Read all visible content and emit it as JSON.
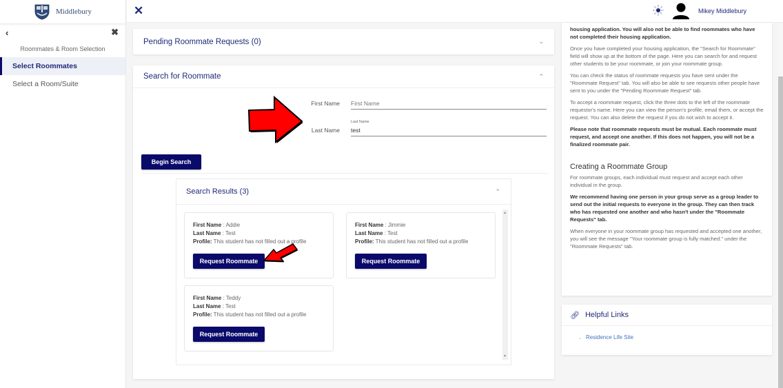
{
  "brand": {
    "name": "Middlebury"
  },
  "sidebar": {
    "section_title": "Roommates & Room Selection",
    "items": [
      {
        "label": "Select Roommates",
        "active": true
      },
      {
        "label": "Select a Room/Suite",
        "active": false
      }
    ]
  },
  "topbar": {
    "user_name": "Mikey Middlebury"
  },
  "pending_panel": {
    "title": "Pending Roommate Requests (0)"
  },
  "search_panel": {
    "title": "Search for Roommate",
    "first_name": {
      "label": "First Name",
      "placeholder": "First Name",
      "value": ""
    },
    "last_name": {
      "label": "Last Name",
      "float_label": "Last Name",
      "value": "test"
    },
    "begin_button": "Begin Search"
  },
  "results_panel": {
    "title": "Search Results",
    "count": "(3)",
    "labels": {
      "first": "First Name",
      "last": "Last Name",
      "profile": "Profile:"
    },
    "request_button": "Request Roommate",
    "results": [
      {
        "first": "Addie",
        "last": "Test",
        "profile": "This student has not filled out a profile"
      },
      {
        "first": "Jimmie",
        "last": "Test",
        "profile": "This student has not filled out a profile"
      },
      {
        "first": "Teddy",
        "last": "Test",
        "profile": "This student has not filled out a profile"
      }
    ]
  },
  "info_panel": {
    "p1": "housing application. You will also not be able to find roommates who have not completed their housing application.",
    "p2": "Once you have completed your housing application, the \"Search for Roommate\" field will show up at the bottom of the page. Here you can search for and request other students to be your roommate, or join your roommate group.",
    "p3": "You can check the status of roommate requests you have sent under the \"Roommate Request\" tab. You will also be able to see requests other people have sent to you under the \"Pending Roommate Request\" tab.",
    "p4": "To accept a roommate request, click the three dots to the left of the roommate requestor's name. Here you can view the person's profile, email them, or accept the request. You can also delete the request if you do not wish to accept it.",
    "p5": "Please note that roommate requests must be mutual. Each roommate must request, and accept one another. If this does not happen, you will not be a finalized roommate pair.",
    "group_heading": "Creating a Roommate Group",
    "g1": "For roommate groups, each individual must request and accept each other individual in the group.",
    "g2": "We recommend having one person in your group serve as a group leader to send out the initial requests to everyone in the group. They can then track who has requested one another and who hasn't under the \"Roommate Requests\" tab.",
    "g3": "When everyone in your roommate group has requested and accepted one another, you will see the message \"Your roommate group is fully matched.\" under the \"Roommate Requests\" tab."
  },
  "links_panel": {
    "title": "Helpful Links",
    "links": [
      {
        "label": "Residence Life Site"
      }
    ]
  },
  "annotations": {
    "arrow_color": "#ff0000"
  },
  "colors": {
    "primary": "#0a0a6b",
    "heading": "#1f2a78",
    "link": "#3d74b8"
  }
}
